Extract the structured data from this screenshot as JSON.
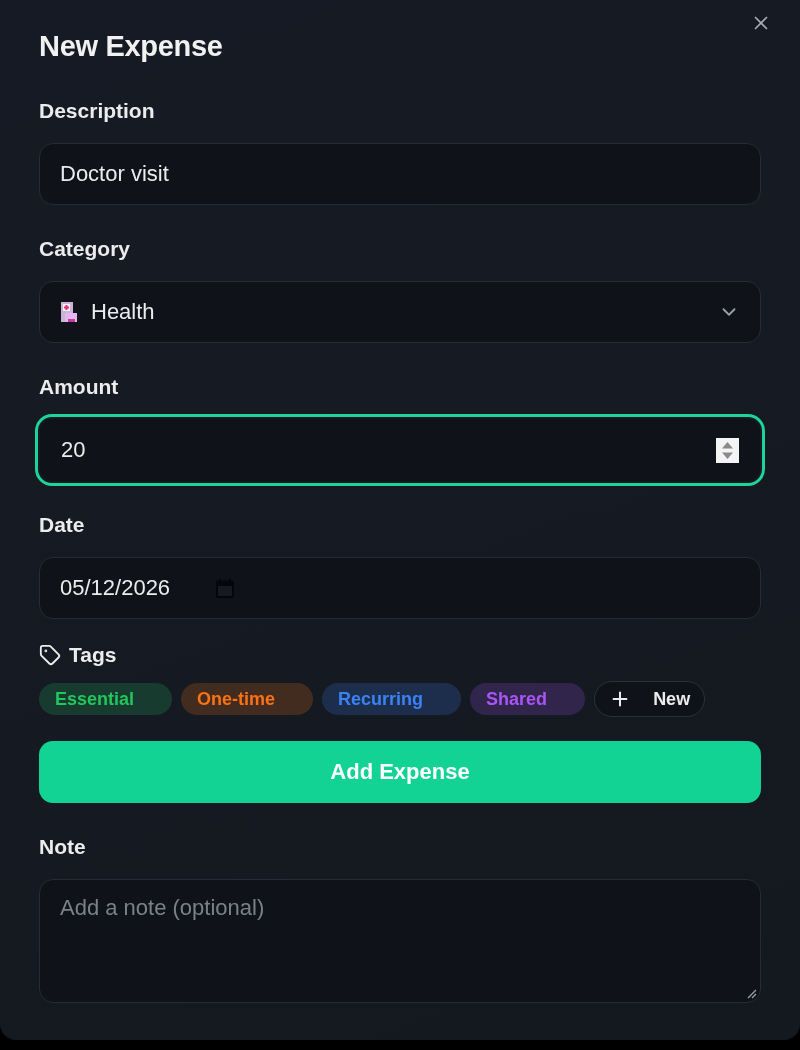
{
  "dialog": {
    "title": "New Expense"
  },
  "fields": [
    {
      "kind": "text",
      "label": "Description",
      "value": "Doctor visit",
      "focused": false
    },
    {
      "kind": "select",
      "label": "Category",
      "value": "Health",
      "focused": false
    },
    {
      "kind": "number",
      "label": "Amount",
      "value": "20",
      "focused": true
    },
    {
      "kind": "date",
      "label": "Date",
      "value": "05/12/2026",
      "focused": false
    }
  ],
  "tags": {
    "label": "Tags",
    "items": [
      {
        "label": "Essential",
        "color": "#22c55e"
      },
      {
        "label": "One-time",
        "color": "#f97316"
      },
      {
        "label": "Recurring",
        "color": "#3b82f6"
      },
      {
        "label": "Shared",
        "color": "#a855f7"
      }
    ],
    "new_button": "New"
  },
  "submit_button": "Add Expense",
  "note": {
    "label": "Note",
    "placeholder": "Add a note (optional)"
  }
}
